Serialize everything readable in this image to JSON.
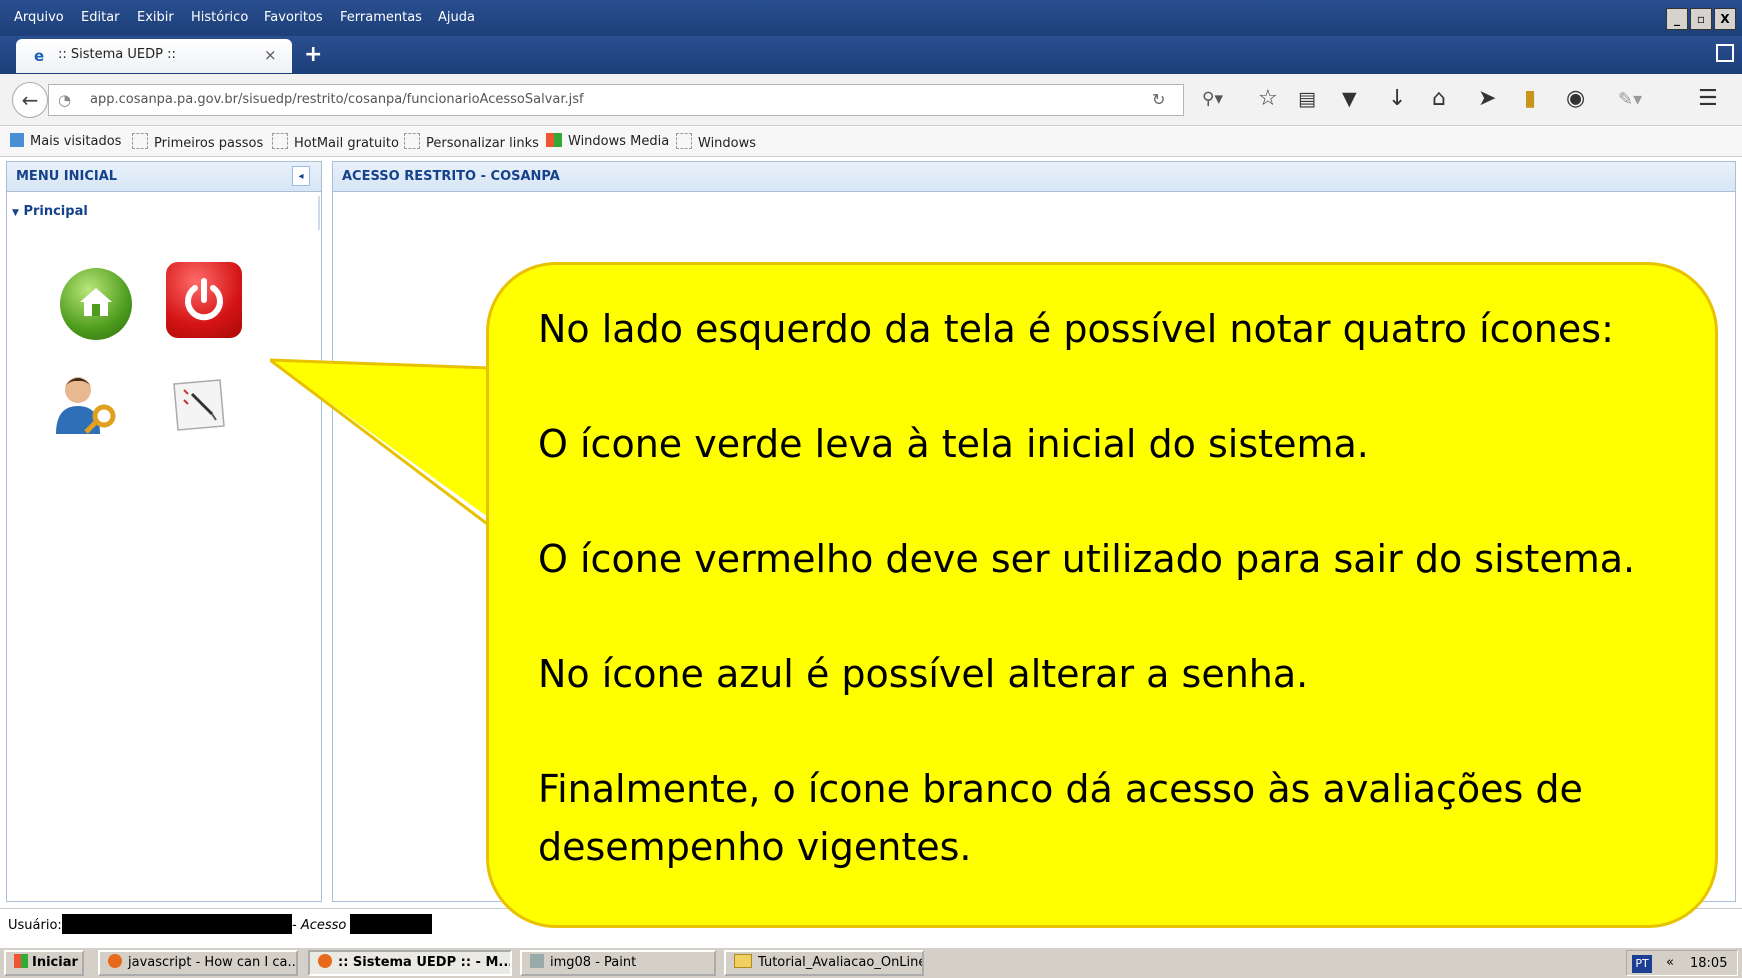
{
  "menubar": {
    "items": [
      "Arquivo",
      "Editar",
      "Exibir",
      "Histórico",
      "Favoritos",
      "Ferramentas",
      "Ajuda"
    ],
    "window_controls": [
      "_",
      "▫",
      "X"
    ]
  },
  "tab": {
    "title": ":: Sistema UEDP ::",
    "close": "×",
    "new_tab": "+"
  },
  "nav": {
    "url": "app.cosanpa.pa.gov.br/sisuedp/restrito/cosanpa/funcionarioAcessoSalvar.jsf",
    "toolbar_icons": [
      "search-icon",
      "star-icon",
      "reading-list-icon",
      "pocket-icon",
      "download-icon",
      "home-icon",
      "send-icon",
      "bookmark-icon",
      "chat-icon",
      "addon-icon",
      "menu-icon"
    ]
  },
  "bookmarks": [
    "Mais visitados",
    "Primeiros passos",
    "HotMail gratuito",
    "Personalizar links",
    "Windows Media",
    "Windows"
  ],
  "left_panel": {
    "title": "MENU INICIAL",
    "collapse": "◂",
    "section": "Principal"
  },
  "right_panel": {
    "title": "ACESSO RESTRITO - COSANPA"
  },
  "status": {
    "user_label": "Usuário:",
    "acesso_label": "- Acesso"
  },
  "taskbar": {
    "start": "Iniciar",
    "tasks": [
      "javascript - How can I ca...",
      ":: Sistema UEDP :: - M...",
      "img08 - Paint",
      "Tutorial_Avaliacao_OnLine"
    ],
    "lang": "PT",
    "arrow": "«",
    "clock": "18:05"
  },
  "callout": {
    "lines": [
      "No lado esquerdo da tela é possível notar quatro ícones:",
      "O ícone verde leva à tela inicial do sistema.",
      "O ícone vermelho deve ser utilizado para sair do sistema.",
      "No ícone azul é possível alterar a senha.",
      "Finalmente, o ícone branco dá acesso às avaliações de desempenho vigentes."
    ]
  },
  "colors": {
    "titlebar": "#1d3f7a",
    "panel_header": "#d7e5f5",
    "callout": "#ffff00",
    "home_icon": "#4e9c1d",
    "power_icon": "#d41414"
  }
}
